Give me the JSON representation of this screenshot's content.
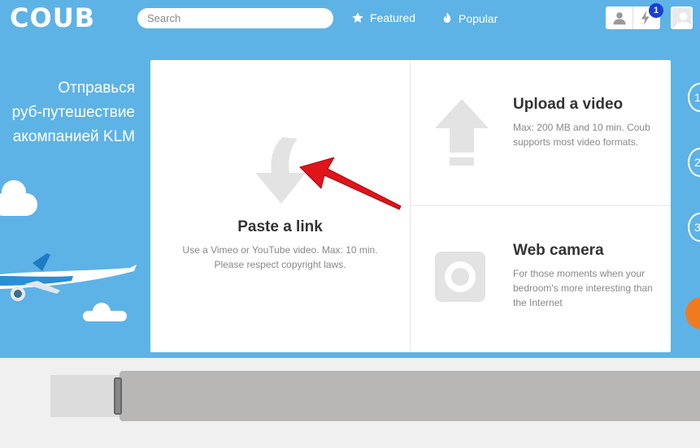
{
  "header": {
    "logo": "COUB",
    "search_placeholder": "Search",
    "nav": {
      "featured": "Featured",
      "popular": "Popular"
    },
    "notification_count": "1"
  },
  "promo": {
    "lines": [
      "Отправься",
      "руб-путешествие",
      "акомпанией KLM"
    ]
  },
  "options": {
    "paste": {
      "title": "Paste a link",
      "desc_line1": "Use a Vimeo or YouTube video. Max: 10 min.",
      "desc_line2": "Please respect copyright laws."
    },
    "upload": {
      "title": "Upload a video",
      "desc": "Max: 200 MB and 10 min. Coub supports most video formats."
    },
    "webcam": {
      "title": "Web camera",
      "desc": "For those moments when your bedroom's more interesting than the Internet"
    }
  },
  "side_controls": [
    "1",
    "2",
    "3"
  ],
  "colors": {
    "background_blue": "#5db3e6",
    "annotation_arrow": "#e0141b",
    "badge": "#1a3fd6",
    "orange_button": "#f07b1f"
  },
  "icons": [
    "star-icon",
    "flame-icon",
    "user-icon",
    "bolt-icon",
    "avatar-icon",
    "curved-arrow-icon",
    "upload-arrow-icon",
    "webcam-icon"
  ]
}
